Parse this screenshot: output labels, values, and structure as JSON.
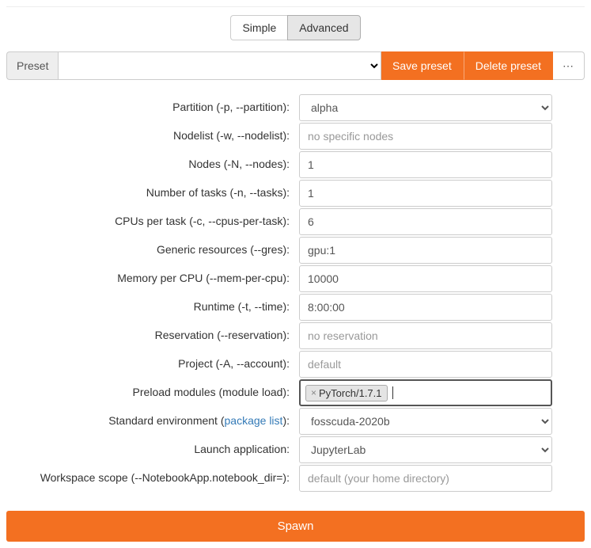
{
  "tabs": {
    "simple": "Simple",
    "advanced": "Advanced"
  },
  "preset": {
    "label": "Preset",
    "save": "Save preset",
    "delete": "Delete preset",
    "more": "⋯"
  },
  "fields": {
    "partition": {
      "label": "Partition (-p, --partition):",
      "value": "alpha"
    },
    "nodelist": {
      "label": "Nodelist (-w, --nodelist):",
      "placeholder": "no specific nodes",
      "value": ""
    },
    "nodes": {
      "label": "Nodes (-N, --nodes):",
      "value": "1"
    },
    "tasks": {
      "label": "Number of tasks (-n, --tasks):",
      "value": "1"
    },
    "cpus": {
      "label": "CPUs per task (-c, --cpus-per-task):",
      "value": "6"
    },
    "gres": {
      "label": "Generic resources (--gres):",
      "value": "gpu:1"
    },
    "mem": {
      "label": "Memory per CPU (--mem-per-cpu):",
      "value": "10000"
    },
    "time": {
      "label": "Runtime (-t, --time):",
      "value": "8:00:00"
    },
    "reservation": {
      "label": "Reservation (--reservation):",
      "placeholder": "no reservation",
      "value": ""
    },
    "project": {
      "label": "Project (-A, --account):",
      "placeholder": "default",
      "value": ""
    },
    "modules": {
      "label": "Preload modules (module load):",
      "tags": [
        "PyTorch/1.7.1"
      ]
    },
    "env": {
      "label_pre": "Standard environment (",
      "label_link": "package list",
      "label_post": "):",
      "value": "fosscuda-2020b"
    },
    "launch": {
      "label": "Launch application:",
      "value": "JupyterLab"
    },
    "workspace": {
      "label": "Workspace scope (--NotebookApp.notebook_dir=):",
      "placeholder": "default (your home directory)",
      "value": ""
    }
  },
  "spawn": "Spawn"
}
